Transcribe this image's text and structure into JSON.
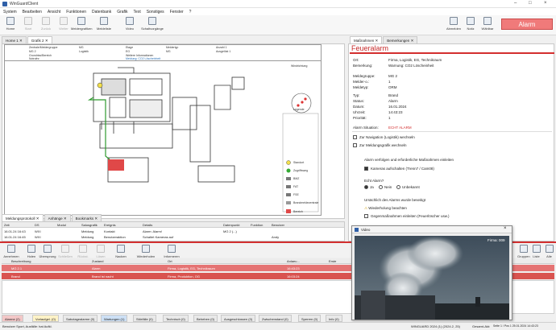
{
  "window": {
    "title": "WinGuardClient"
  },
  "menu": [
    "System",
    "Bearbeiten",
    "Ansicht",
    "Funktionen",
    "Datenbank",
    "Grafik",
    "Text",
    "Sonstiges",
    "Fenster",
    "?"
  ],
  "toolbar": {
    "left": [
      {
        "label": "Home",
        "enabled": true
      },
      {
        "label": "Start",
        "enabled": false
      },
      {
        "label": "Zurück",
        "enabled": false
      },
      {
        "label": "Weiter",
        "enabled": false
      },
      {
        "label": "Meldergrafiken",
        "enabled": true
      },
      {
        "label": "Meldeliste",
        "enabled": true
      },
      {
        "label": "Video",
        "enabled": true
      },
      {
        "label": "Schaltvorgänge",
        "enabled": true
      }
    ],
    "right": [
      {
        "label": "Abmelden"
      },
      {
        "label": "Notiz"
      },
      {
        "label": "Wählbar"
      }
    ],
    "alarm_button": "Alarm"
  },
  "left_tabs": {
    "tab1": "Home 1",
    "tab2": "Grafik 2"
  },
  "plan_header": {
    "r1": [
      "Zentrale/Meldergruppe",
      "MG",
      "Etage",
      "Meldertyp",
      "Anzahl 1"
    ],
    "r1v": [
      "MG 2",
      "Logistik",
      "EG",
      "MG",
      "Ausgelöst 1"
    ],
    "r2": [
      "Grundriss/Bereich",
      "Weitere Informationen"
    ],
    "r2v": [
      "Notrufnr.",
      "Meldung: CO2 Löscheinheit"
    ]
  },
  "plan": {
    "compass_title": "Windrichtung",
    "legend_title": "Legende",
    "legend": [
      "Standort",
      "Zugriffsweg",
      "BMZ",
      "FAT",
      "FSE",
      "Brandmeldezentrale",
      "Bereich"
    ]
  },
  "right_tabs": {
    "tab1": "Maßnahmen",
    "tab2": "Bemerkungen"
  },
  "alarm": {
    "heading": "Feueralarm",
    "ort_label": "Ort:",
    "ort_value": "Firma, Logistik, EG, Technikraum",
    "bemerkung_label": "Bemerkung:",
    "bemerkung_value": "Warnung: CO2 Löscheinheit",
    "meldegruppe_label": "Meldegruppe:",
    "meldegruppe_value": "MG 2",
    "melder_label": "Melder-o.:",
    "melder_value": "1",
    "meldetyp_label": "Meldetyp:",
    "meldetyp_value": "ORM",
    "typ_label": "Typ:",
    "typ_value": "Brand",
    "status_label": "Status:",
    "status_value": "Alarm",
    "datum_label": "Datum:",
    "datum_value": "16.01.2024",
    "uhrzeit_label": "Uhrzeit:",
    "uhrzeit_value": "14:43:23",
    "prio_label": "Priorität:",
    "prio_value": "1",
    "situation_label": "Alarm Situation:",
    "situation_value": "ECHT ALARM",
    "step1": "Zur Navigation (Logistik) wechseln",
    "step2": "Zur Meldungsgrafik wechseln",
    "instruction": "Alarm verfolgen und erforderliche Maßnahmen einleiten",
    "check_camera": "Kameras aufschalten (Trenn7 / Cam08)",
    "question": "Echt Alarm?",
    "opt1": "Ja",
    "opt2": "Nein",
    "opt3": "Unbekannt",
    "question2": "Ursächlich des Alarms wurde beseitigt",
    "step3": "Wiederholung beachten",
    "step4": "Gegenmaßnahmen einleiten (Feuerlöscher usw.)"
  },
  "log_tabs": {
    "tab1": "Meldungsprotokoll",
    "tab2": "Anhänge",
    "tab3": "Bookmarks"
  },
  "log": {
    "columns": [
      "Zeit",
      "DS",
      "Modul",
      "Salusgrafik",
      "Ereignis",
      "Details",
      "Datenpunkt",
      "Funktion",
      "Benutzer"
    ],
    "rows": [
      [
        "16.01.24 16:43",
        "WXI",
        "",
        "Meldung",
        "Kontakt",
        "Alarm: Alarm!",
        "MG 2 (...)",
        "",
        ""
      ],
      [
        "16.01.24 16:45",
        "WXI",
        "",
        "Meldung",
        "Benutzeraktion",
        "Schaltet Kameras auf",
        "",
        "",
        "Andy"
      ]
    ]
  },
  "bottom_toolbar": [
    "Annehmen",
    "Holen",
    "Übersprung",
    "Schließen",
    "Rückst. Grp.",
    "Lösen",
    "Nacken",
    "Wiederholen",
    "Informeren"
  ],
  "bottom_toolbar_right": [
    "Gruppen",
    "Liste",
    "Alle"
  ],
  "alarmlist": {
    "columns": [
      "Beschreibung",
      "Zustand",
      "Ort",
      "Anlaeu...",
      "Erste"
    ],
    "rows": [
      [
        "MG 2.1",
        "Alarm",
        "Firma, Logistik, EG, Technikraum",
        "16:43:23",
        ""
      ],
      [
        "Brand",
        "Brand ist nacht",
        "Firma, Produktion, OG",
        "16:03:24",
        ""
      ]
    ]
  },
  "bottom_tabs": [
    "Alarme (2)",
    "Vorlaufgel. (0)",
    "Sabotagealarme (0)",
    "Wartungen (1)",
    "Störfälle (0)",
    "Technisch (0)",
    "Beheben (0)",
    "Ausgeschlossen (0)",
    "Zwischenstand (0)",
    "Sperren (0)",
    "Info (0)"
  ],
  "video": {
    "title": "Video",
    "overlay": "Firma: 009"
  },
  "status": {
    "left": "Benutzer Sport, Ausfälle: hat Aufkl.",
    "right_a": "WINGUARD 2024 (1) (2024.2, 25)",
    "right_b": "Gesamt-Akt:",
    "right_c": "Seite 1 / Pos 1 25.01.2024 14:43:23"
  },
  "colors": {
    "accent": "#d32f2f",
    "alarmrow": "#e57373",
    "selected": "#2f5fa7"
  }
}
